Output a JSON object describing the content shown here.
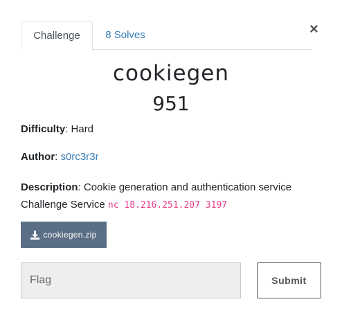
{
  "tabs": {
    "challenge_label": "Challenge",
    "solves_label": "8 Solves"
  },
  "close_icon": "×",
  "challenge": {
    "name": "cookiegen",
    "points": "951"
  },
  "difficulty": {
    "label": "Difficulty",
    "value": "Hard"
  },
  "author": {
    "label": "Author",
    "value": "s0rc3r3r"
  },
  "description": {
    "label": "Description",
    "text": "Cookie generation and authentication service",
    "service_prefix": "Challenge Service ",
    "service_cmd": "nc 18.216.251.207 3197"
  },
  "file": {
    "label": "cookiegen.zip",
    "icon": "download-icon"
  },
  "flag": {
    "placeholder": "Flag",
    "value": ""
  },
  "submit_label": "Submit",
  "colors": {
    "link": "#337ab7",
    "file_button": "#5a6f86",
    "code": "#e83e8c"
  }
}
